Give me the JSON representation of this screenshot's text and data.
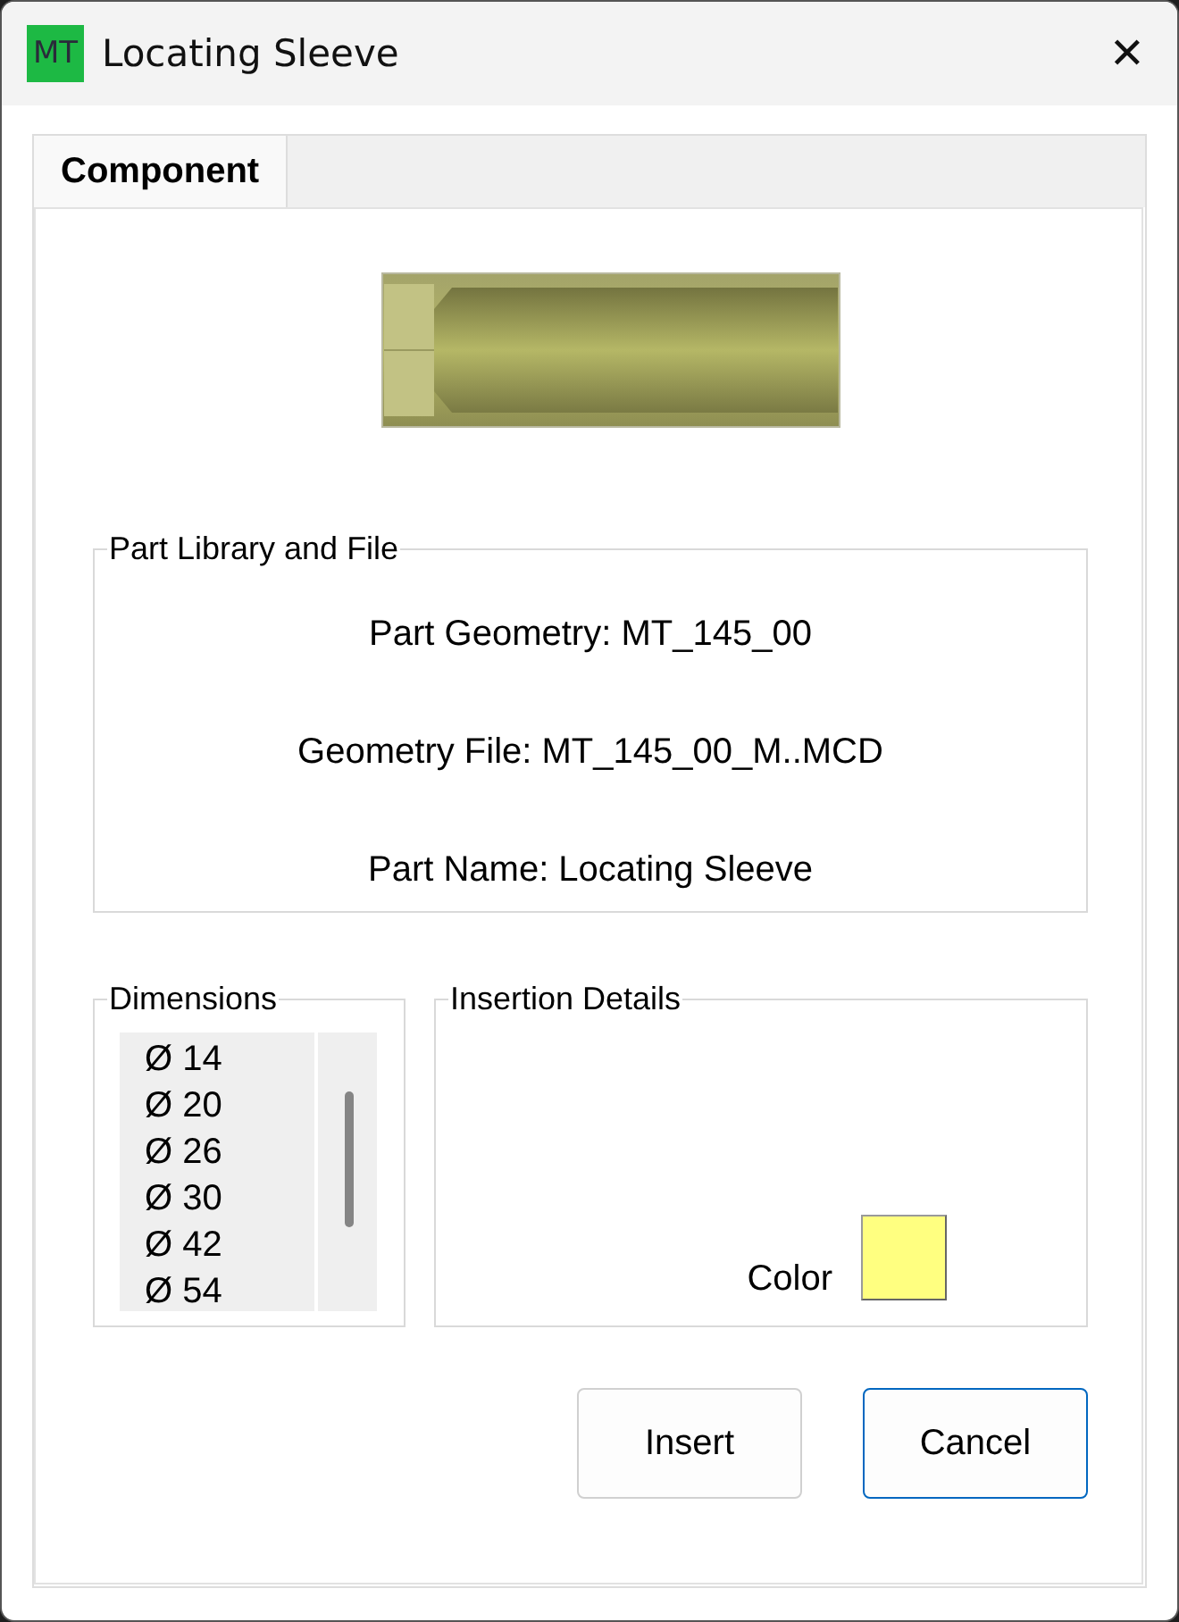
{
  "window": {
    "logo": "MT",
    "title": "Locating Sleeve",
    "close": "✕"
  },
  "tabs": [
    {
      "label": "Component",
      "selected": true
    }
  ],
  "part_library": {
    "title": "Part Library and File",
    "lines": [
      "Part Geometry: MT_145_00",
      "Geometry File: MT_145_00_M..MCD",
      "Part Name: Locating Sleeve"
    ]
  },
  "dimensions": {
    "title": "Dimensions",
    "items": [
      {
        "label": "Ø 14",
        "selected": false
      },
      {
        "label": "Ø 20",
        "selected": false
      },
      {
        "label": "Ø 26",
        "selected": false
      },
      {
        "label": "Ø 30",
        "selected": false
      },
      {
        "label": "Ø 42",
        "selected": false
      },
      {
        "label": "Ø 54",
        "selected": false
      }
    ]
  },
  "insertion_details": {
    "title": "Insertion Details",
    "color_label": "Color",
    "color": "#ffff80"
  },
  "buttons": [
    {
      "label": "Insert",
      "focused": false
    },
    {
      "label": "Cancel",
      "focused": true
    }
  ]
}
